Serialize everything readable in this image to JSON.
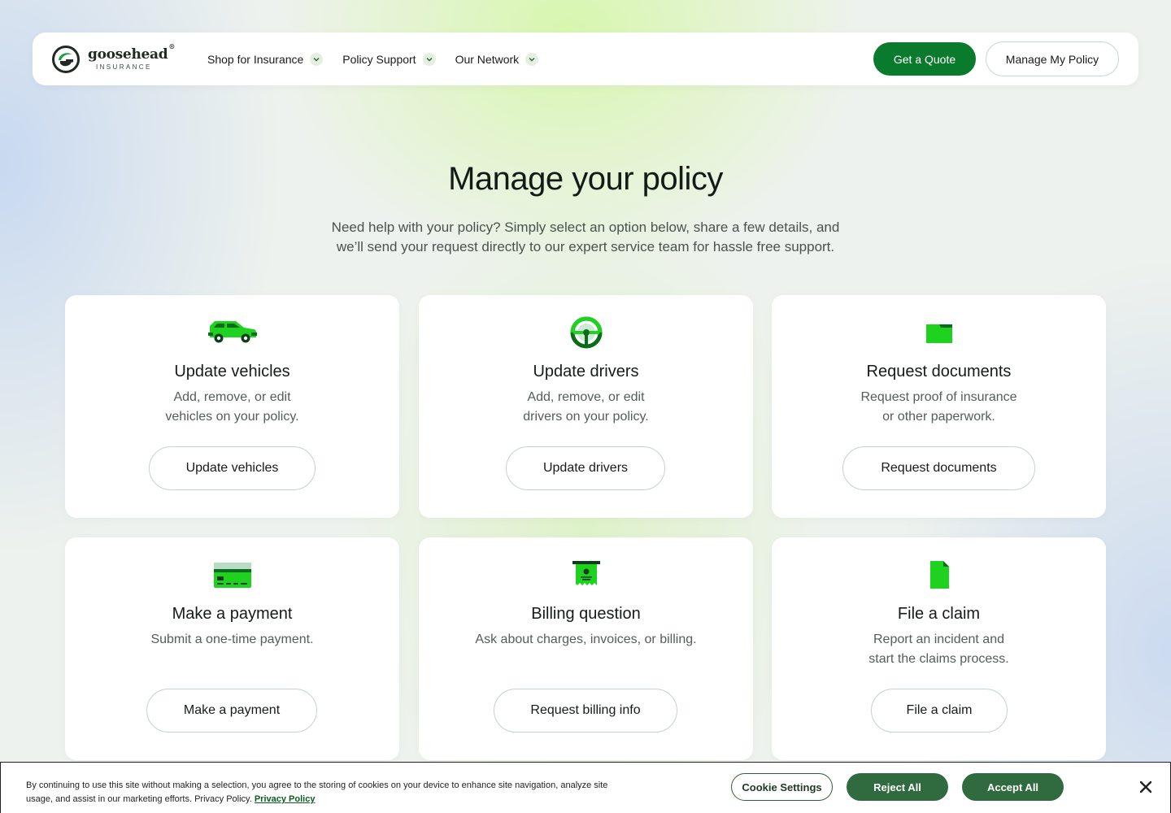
{
  "brand": {
    "name": "goosehead",
    "registered": "®",
    "sub": "INSURANCE",
    "accent": "#0a7a2c"
  },
  "nav": {
    "items": [
      {
        "label": "Shop for Insurance"
      },
      {
        "label": "Policy Support"
      },
      {
        "label": "Our Network"
      }
    ],
    "quote_label": "Get a Quote",
    "manage_label": "Manage My Policy"
  },
  "hero": {
    "title": "Manage your policy",
    "subtitle_line1": "Need help with your policy? Simply select an option below, share a few details, and",
    "subtitle_line2": "we’ll send your request directly to our expert service team for hassle free support."
  },
  "cards": [
    {
      "icon": "car-icon",
      "title": "Update vehicles",
      "desc_line1": "Add, remove, or edit",
      "desc_line2": "vehicles on your policy.",
      "button": "Update vehicles"
    },
    {
      "icon": "steering-wheel-icon",
      "title": "Update drivers",
      "desc_line1": "Add, remove, or edit",
      "desc_line2": "drivers on your policy.",
      "button": "Update drivers"
    },
    {
      "icon": "folder-icon",
      "title": "Request documents",
      "desc_line1": "Request proof of insurance",
      "desc_line2": "or other paperwork.",
      "button": "Request documents"
    },
    {
      "icon": "credit-card-icon",
      "title": "Make a payment",
      "desc_line1": "Submit a one-time payment.",
      "desc_line2": "",
      "button": "Make a payment"
    },
    {
      "icon": "receipt-icon",
      "title": "Billing question",
      "desc_line1": "Ask about charges, invoices, or billing.",
      "desc_line2": "",
      "button": "Request billing info"
    },
    {
      "icon": "document-icon",
      "title": "File a claim",
      "desc_line1": "Report an incident and",
      "desc_line2": "start the claims process.",
      "button": "File a claim"
    }
  ],
  "cookie": {
    "text_line1": "By continuing to use this site without making a selection, you agree to the storing of cookies on your device to enhance site navigation, analyze site",
    "text_line2": "usage, and assist in our marketing efforts. Privacy Policy.",
    "link": "Privacy Policy",
    "settings": "Cookie Settings",
    "reject": "Reject All",
    "accept": "Accept All"
  }
}
